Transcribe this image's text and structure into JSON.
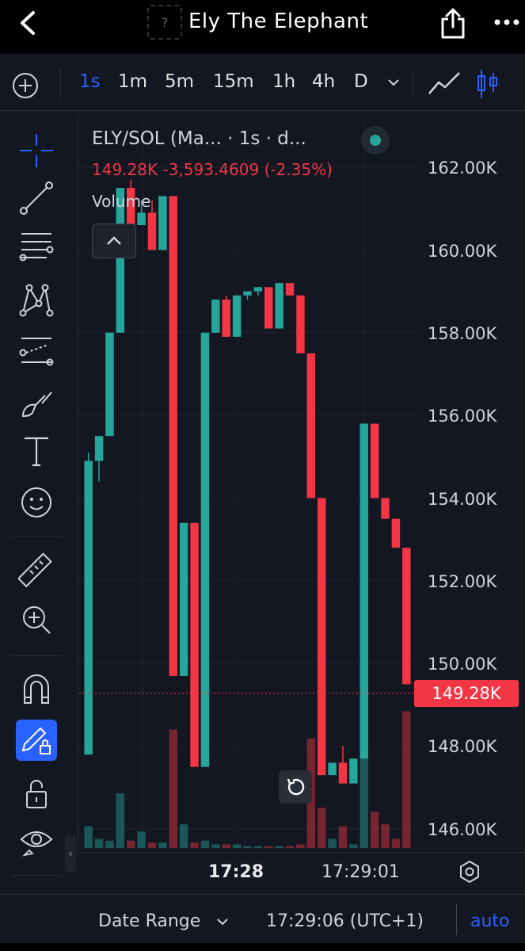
{
  "header": {
    "title": "Ely The Elephant",
    "token_placeholder_glyph": "?"
  },
  "timeframes": [
    {
      "label": "1s",
      "active": true
    },
    {
      "label": "1m",
      "active": false
    },
    {
      "label": "5m",
      "active": false
    },
    {
      "label": "15m",
      "active": false
    },
    {
      "label": "1h",
      "active": false
    },
    {
      "label": "4h",
      "active": false
    },
    {
      "label": "D",
      "active": false
    }
  ],
  "legend": {
    "symbol": "ELY/SOL (Ma... · 1s · d...",
    "last_price": "149.28K",
    "change": "-3,593.4609",
    "change_pct": "(-2.35%)",
    "volume_label": "Volume"
  },
  "price_axis": [
    "162.00K",
    "160.00K",
    "158.00K",
    "156.00K",
    "154.00K",
    "152.00K",
    "150.00K",
    "148.00K",
    "146.00K"
  ],
  "current_price_tag": "149.28K",
  "time_axis": {
    "bold": "17:28",
    "normal": "17:29:01"
  },
  "bottom": {
    "date_range": "Date Range",
    "clock": "17:29:06 (UTC+1)",
    "scale": "auto"
  },
  "colors": {
    "up": "#26a69a",
    "down": "#f23645",
    "accent": "#2962ff",
    "background": "#131722"
  },
  "chart_data": {
    "type": "candlestick",
    "ylim": [
      145.5,
      162.7
    ],
    "current_price": 149.28,
    "candles": [
      {
        "o": 147.8,
        "h": 155.1,
        "l": 147.8,
        "c": 154.9,
        "v": 0.12
      },
      {
        "o": 154.9,
        "h": 155.5,
        "l": 154.4,
        "c": 155.5,
        "v": 0.05
      },
      {
        "o": 155.5,
        "h": 158.0,
        "l": 155.5,
        "c": 158.0,
        "v": 0.04
      },
      {
        "o": 158.0,
        "h": 161.5,
        "l": 158.0,
        "c": 161.5,
        "v": 0.3
      },
      {
        "o": 161.5,
        "h": 161.7,
        "l": 160.2,
        "c": 160.6,
        "v": 0.04
      },
      {
        "o": 160.6,
        "h": 161.2,
        "l": 160.6,
        "c": 160.9,
        "v": 0.09
      },
      {
        "o": 160.9,
        "h": 161.2,
        "l": 160.0,
        "c": 160.0,
        "v": 0.03
      },
      {
        "o": 160.0,
        "h": 161.3,
        "l": 160.0,
        "c": 161.3,
        "v": 0.03
      },
      {
        "o": 161.3,
        "h": 161.3,
        "l": 149.7,
        "c": 149.7,
        "v": 0.65
      },
      {
        "o": 149.7,
        "h": 149.7,
        "l": 153.4,
        "c": 153.4,
        "v": 0.13
      },
      {
        "o": 153.4,
        "h": 153.4,
        "l": 147.5,
        "c": 147.5,
        "v": 0.03
      },
      {
        "o": 147.5,
        "h": 158.0,
        "l": 147.5,
        "c": 158.0,
        "v": 0.04
      },
      {
        "o": 158.0,
        "h": 158.8,
        "l": 158.0,
        "c": 158.8,
        "v": 0.02
      },
      {
        "o": 158.8,
        "h": 158.9,
        "l": 157.9,
        "c": 157.9,
        "v": 0.02
      },
      {
        "o": 157.9,
        "h": 158.9,
        "l": 157.9,
        "c": 158.9,
        "v": 0.02
      },
      {
        "o": 158.9,
        "h": 159.0,
        "l": 158.8,
        "c": 159.0,
        "v": 0.01
      },
      {
        "o": 159.0,
        "h": 159.1,
        "l": 158.9,
        "c": 159.1,
        "v": 0.01
      },
      {
        "o": 159.1,
        "h": 159.1,
        "l": 158.1,
        "c": 158.1,
        "v": 0.01
      },
      {
        "o": 158.1,
        "h": 159.2,
        "l": 158.1,
        "c": 159.2,
        "v": 0.01
      },
      {
        "o": 159.2,
        "h": 159.2,
        "l": 158.9,
        "c": 158.9,
        "v": 0.01
      },
      {
        "o": 158.9,
        "h": 158.9,
        "l": 157.5,
        "c": 157.5,
        "v": 0.02
      },
      {
        "o": 157.5,
        "h": 157.5,
        "l": 154.0,
        "c": 154.0,
        "v": 0.6
      },
      {
        "o": 154.0,
        "h": 154.0,
        "l": 147.3,
        "c": 147.3,
        "v": 0.22
      },
      {
        "o": 147.3,
        "h": 147.6,
        "l": 147.3,
        "c": 147.6,
        "v": 0.05
      },
      {
        "o": 147.6,
        "h": 148.0,
        "l": 147.1,
        "c": 147.1,
        "v": 0.12
      },
      {
        "o": 147.1,
        "h": 147.7,
        "l": 147.1,
        "c": 147.7,
        "v": 0.02
      },
      {
        "o": 147.7,
        "h": 155.8,
        "l": 147.7,
        "c": 155.8,
        "v": 0.55
      },
      {
        "o": 155.8,
        "h": 155.8,
        "l": 154.0,
        "c": 154.0,
        "v": 0.2
      },
      {
        "o": 154.0,
        "h": 154.0,
        "l": 153.5,
        "c": 153.5,
        "v": 0.13
      },
      {
        "o": 153.5,
        "h": 153.5,
        "l": 152.8,
        "c": 152.8,
        "v": 0.05
      },
      {
        "o": 152.8,
        "h": 152.8,
        "l": 149.5,
        "c": 149.5,
        "v": 0.75
      }
    ]
  }
}
